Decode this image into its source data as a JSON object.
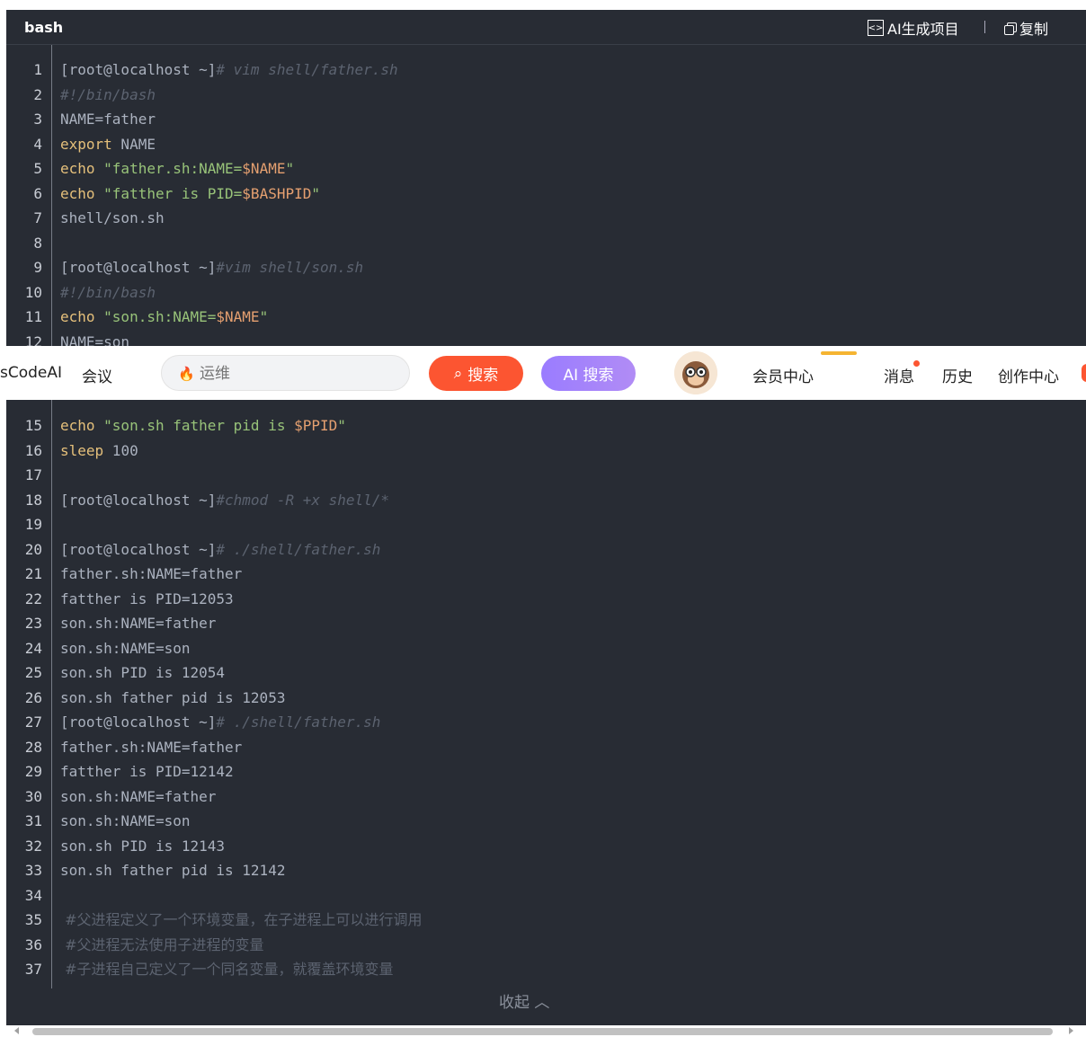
{
  "code_header": {
    "language": "bash",
    "ai_label": "AI生成项目",
    "copy_label": "复制"
  },
  "lines": [
    {
      "n": "1"
    },
    {
      "n": "2"
    },
    {
      "n": "3"
    },
    {
      "n": "4"
    },
    {
      "n": "5"
    },
    {
      "n": "6"
    },
    {
      "n": "7"
    },
    {
      "n": "8"
    },
    {
      "n": "9"
    },
    {
      "n": "10"
    },
    {
      "n": "11"
    },
    {
      "n": "12"
    },
    {
      "n": "15"
    },
    {
      "n": "16"
    },
    {
      "n": "17"
    },
    {
      "n": "18"
    },
    {
      "n": "19"
    },
    {
      "n": "20"
    },
    {
      "n": "21"
    },
    {
      "n": "22"
    },
    {
      "n": "23"
    },
    {
      "n": "24"
    },
    {
      "n": "25"
    },
    {
      "n": "26"
    },
    {
      "n": "27"
    },
    {
      "n": "28"
    },
    {
      "n": "29"
    },
    {
      "n": "30"
    },
    {
      "n": "31"
    },
    {
      "n": "32"
    },
    {
      "n": "33"
    },
    {
      "n": "34"
    },
    {
      "n": "35"
    },
    {
      "n": "36"
    },
    {
      "n": "37"
    }
  ],
  "code": {
    "l1_prompt": "[root@localhost ~]",
    "l1_cmd": "# vim shell/father.sh",
    "l2": "#!/bin/bash",
    "l3": "NAME=father",
    "l4_kw": "export",
    "l4_rest": " NAME",
    "l5_kw": "echo",
    "l5_str": " \"father.sh:NAME=",
    "l5_var": "$NAME",
    "l5_end": "\"",
    "l6_kw": "echo",
    "l6_str": " \"fatther is PID=",
    "l6_var": "$BASHPID",
    "l6_end": "\"",
    "l7": "shell/son.sh",
    "l9_prompt": "[root@localhost ~]",
    "l9_cmd": "#vim shell/son.sh",
    "l10": "#!/bin/bash",
    "l11_kw": "echo",
    "l11_str": " \"son.sh:NAME=",
    "l11_var": "$NAME",
    "l11_end": "\"",
    "l12": "NAME=son",
    "l15_kw": "echo",
    "l15_str": " \"son.sh father pid is ",
    "l15_var": "$PPID",
    "l15_end": "\"",
    "l16_kw": "sleep",
    "l16_rest": " 100",
    "l18_prompt": "[root@localhost ~]",
    "l18_cmd": "#chmod -R +x shell/*",
    "l20_prompt": "[root@localhost ~]",
    "l20_cmd": "# ./shell/father.sh",
    "l21": "father.sh:NAME=father",
    "l22": "fatther is PID=12053",
    "l23": "son.sh:NAME=father",
    "l24": "son.sh:NAME=son",
    "l25": "son.sh PID is 12054",
    "l26": "son.sh father pid is 12053",
    "l27_prompt": "[root@localhost ~]",
    "l27_cmd": "# ./shell/father.sh",
    "l28": "father.sh:NAME=father",
    "l29": "fatther is PID=12142",
    "l30": "son.sh:NAME=father",
    "l31": "son.sh:NAME=son",
    "l32": "son.sh PID is 12143",
    "l33": "son.sh father pid is 12142",
    "l35": " #父进程定义了一个环境变量，在子进程上可以进行调用",
    "l36": " #父进程无法使用子进程的变量",
    "l37": " #子进程自己定义了一个同名变量，就覆盖环境变量"
  },
  "collapse_label": "收起 ︿",
  "topbar": {
    "nav_left1": "sCodeAI",
    "nav_left2": "会议",
    "search_placeholder": "运维",
    "search_button": "搜索",
    "ai_search_button": "AI 搜索",
    "member_center": "会员中心",
    "messages": "消息",
    "history": "历史",
    "creator_center": "创作中心"
  },
  "colors": {
    "code_bg": "#282c34",
    "brand_red": "#fc5531",
    "ai_purple": "#9a7cff"
  }
}
